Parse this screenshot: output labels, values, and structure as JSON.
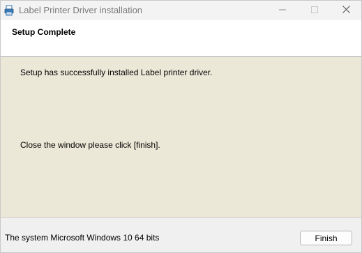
{
  "window": {
    "title": "Label Printer Driver installation",
    "icon": "printer-icon",
    "controls": {
      "minimize": "minimize-icon",
      "maximize": "maximize-icon",
      "close": "close-icon"
    }
  },
  "header": {
    "title": "Setup Complete"
  },
  "body": {
    "message_success": "Setup has successfully installed Label printer driver.",
    "message_close": "Close the window please click [finish]."
  },
  "footer": {
    "system_info": "The system Microsoft Windows 10 64 bits",
    "finish_label": "Finish"
  },
  "colors": {
    "body_background": "#ece8d8",
    "header_background": "#ffffff",
    "titlebar_background": "#f3f3f3"
  }
}
